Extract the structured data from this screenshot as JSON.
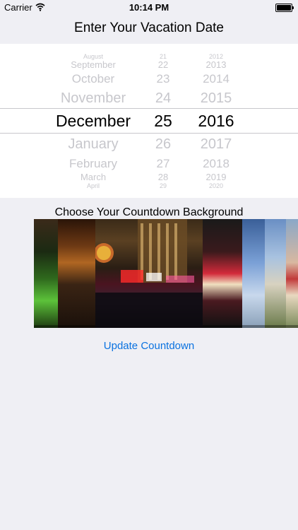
{
  "status_bar": {
    "carrier": "Carrier",
    "time": "10:14 PM"
  },
  "nav": {
    "title": "Enter Your Vacation Date"
  },
  "picker": {
    "months": [
      "August",
      "September",
      "October",
      "November",
      "December",
      "January",
      "February",
      "March",
      "April"
    ],
    "days": [
      "21",
      "22",
      "23",
      "24",
      "25",
      "26",
      "27",
      "28",
      "29"
    ],
    "years": [
      "2012",
      "2013",
      "2014",
      "2015",
      "2016",
      "2017",
      "2018",
      "2019",
      "2020"
    ],
    "selected": {
      "month": "December",
      "day": "25",
      "year": "2016"
    }
  },
  "background_section": {
    "title": "Choose Your Countdown Background",
    "images": [
      {
        "name": "casino-slot-machines",
        "dominant_color": "#2f4a1a"
      },
      {
        "name": "casino-floor",
        "dominant_color": "#3a1f0d"
      },
      {
        "name": "paris-las-vegas-night",
        "dominant_color": "#1e1710"
      },
      {
        "name": "flamingo-sign",
        "dominant_color": "#351418"
      },
      {
        "name": "hotel-tower-sky",
        "dominant_color": "#5f84b8"
      },
      {
        "name": "welcome-sign-palm",
        "dominant_color": "#8fb0d8"
      },
      {
        "name": "las-vegas-sign",
        "dominant_color": "#9a8a6f"
      }
    ]
  },
  "update_button": {
    "label": "Update Countdown"
  },
  "colors": {
    "accent": "#0a72e0",
    "background": "#efeff4",
    "picker_background": "#ffffff",
    "divider": "#c8c7cc"
  }
}
